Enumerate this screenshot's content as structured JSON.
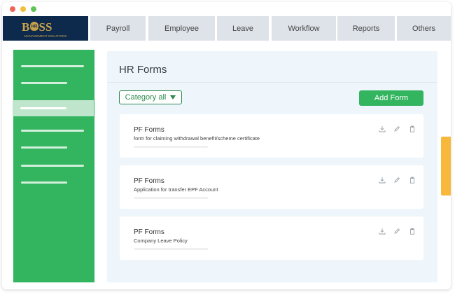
{
  "window": {
    "controls": [
      "close",
      "minimize",
      "maximize"
    ]
  },
  "brand": {
    "logo_mark": "BOSS",
    "logo_badge": "HR",
    "logo_tagline": "MANAGEMENT SOLUTIONS",
    "logo_bg": "#0d2a4d",
    "logo_gold": "#c9a24a"
  },
  "nav": {
    "tabs": [
      "Payroll",
      "Employee",
      "Leave",
      "Workflow",
      "Reports",
      "Others"
    ]
  },
  "sidebar": {
    "item_count": 7,
    "active_index": 2,
    "color": "#33b45f",
    "active_color": "#bfe6cc"
  },
  "main": {
    "title": "HR Forms",
    "category_button": "Category all",
    "add_button": "Add Form",
    "forms": [
      {
        "title": "PF Forms",
        "description": "form for claiming withdrawal benefit/scheme certificate"
      },
      {
        "title": "PF Forms",
        "description": "Application for transfer EPF Account"
      },
      {
        "title": "PF Forms",
        "description": "Company Leave Policy"
      }
    ],
    "card_actions": [
      "download-icon",
      "edit-icon",
      "clipboard-icon"
    ]
  },
  "colors": {
    "accent_green": "#33b45f",
    "tab_bg": "#dde3e8",
    "panel_bg": "#eef6fc",
    "scroll_handle": "#f7b83c"
  }
}
